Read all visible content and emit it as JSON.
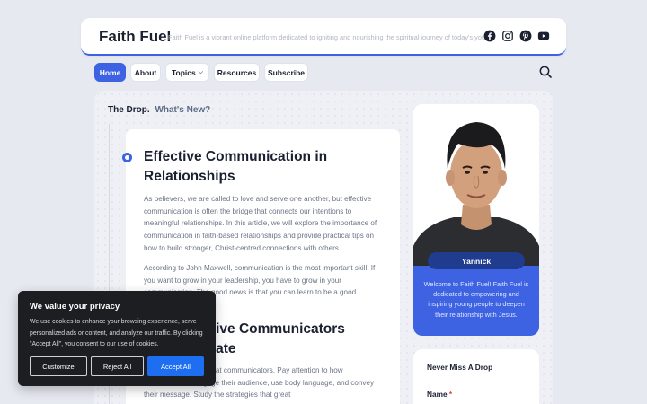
{
  "header": {
    "site_title": "Faith Fuel",
    "tagline": "Faith Fuel is a vibrant online platform dedicated to igniting and nourishing the spiritual journey of today's youth",
    "social_icons": [
      "facebook-icon",
      "instagram-icon",
      "pinterest-icon",
      "youtube-icon"
    ]
  },
  "nav": {
    "items": [
      {
        "label": "Home",
        "active": true
      },
      {
        "label": "About",
        "active": false
      },
      {
        "label": "Topics",
        "active": false,
        "caret": "⌵"
      },
      {
        "label": "Resources",
        "active": false
      },
      {
        "label": "Subscribe",
        "active": false
      }
    ],
    "search_icon": "search-icon"
  },
  "section": {
    "title": "The Drop.",
    "subtitle": "What's New?"
  },
  "article": {
    "title": "Effective Communication in Relationships",
    "paragraph1": "As believers, we are called to love and serve one another, but effective communication is often the bridge that connects our intentions to meaningful relationships. In this article, we will explore the importance of communication in faith-based relationships and provide practical tips on how to build stronger, Christ-centred connections with others.",
    "paragraph2": "According to John Maxwell, communication is the most important skill. If you want to grow in your leadership, you have to grow in your communication. The good news is that you can learn to be a good",
    "heading2": "How Effective Communicators Communicate",
    "paragraph3": "We can learn from great communicators. Pay attention to how communicators engage their audience, use body language, and convey their message. Study the strategies that great"
  },
  "profile": {
    "name": "Yannick",
    "description": "Welcome to Faith Fuel! Faith Fuel is dedicated to empowering and inspiring young people to deepen their relationship with Jesus."
  },
  "newsletter": {
    "title": "Never Miss A Drop",
    "name_label": "Name",
    "required_mark": "*"
  },
  "cookie": {
    "title": "We value your privacy",
    "text": "We use cookies to enhance your browsing experience, serve personalized ads or content, and analyze our traffic. By clicking \"Accept All\", you consent to our use of cookies.",
    "customize_label": "Customize",
    "reject_label": "Reject All",
    "accept_label": "Accept All"
  },
  "colors": {
    "accent": "#3d62e2",
    "background": "#e6e9f0",
    "cookie_bg": "#1d1e22",
    "accept_button": "#1e6ef2"
  }
}
